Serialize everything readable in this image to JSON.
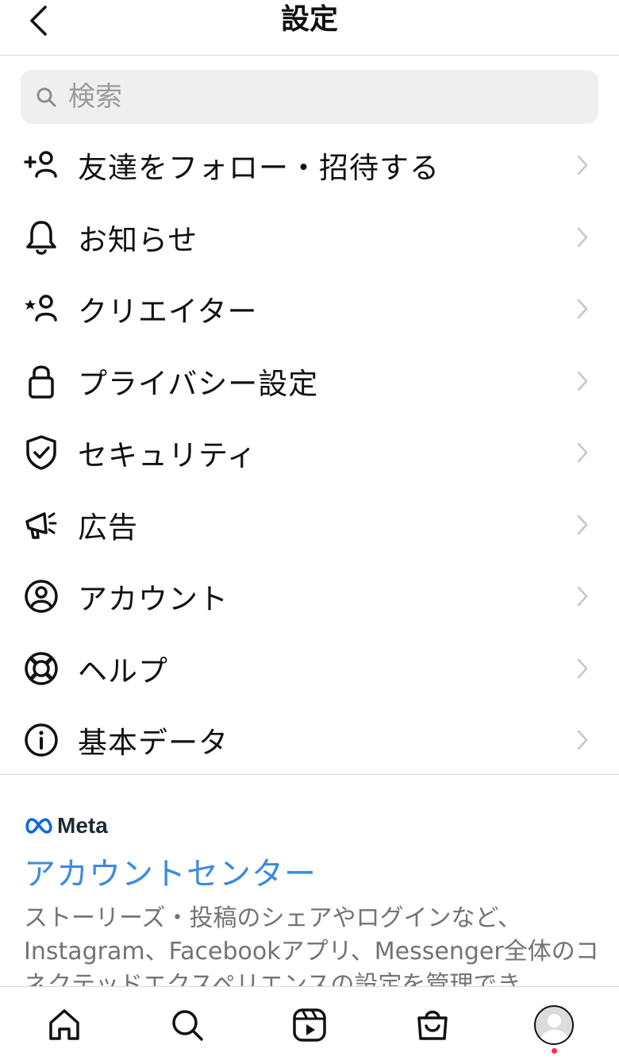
{
  "header": {
    "title": "設定"
  },
  "search": {
    "placeholder": "検索"
  },
  "menu": [
    {
      "label": "友達をフォロー・招待する",
      "icon": "add-person-icon"
    },
    {
      "label": "お知らせ",
      "icon": "bell-icon"
    },
    {
      "label": "クリエイター",
      "icon": "star-person-icon"
    },
    {
      "label": "プライバシー設定",
      "icon": "lock-icon"
    },
    {
      "label": "セキュリティ",
      "icon": "shield-check-icon"
    },
    {
      "label": "広告",
      "icon": "megaphone-icon"
    },
    {
      "label": "アカウント",
      "icon": "account-circle-icon"
    },
    {
      "label": "ヘルプ",
      "icon": "lifebuoy-icon"
    },
    {
      "label": "基本データ",
      "icon": "info-icon"
    }
  ],
  "meta": {
    "brand": "Meta",
    "account_center": "アカウントセンター",
    "description": "ストーリーズ・投稿のシェアやログインなど、Instagram、Facebookアプリ、Messenger全体のコネクテッドエクスペリエンスの設定を管理でき…"
  },
  "tabbar": {
    "items": [
      "home-icon",
      "search-icon",
      "reels-icon",
      "shop-icon",
      "profile-avatar"
    ],
    "notification_dot_color": "#ff3040"
  },
  "colors": {
    "accent": "#3e8ae0",
    "meta_blue": "#0668e1"
  }
}
